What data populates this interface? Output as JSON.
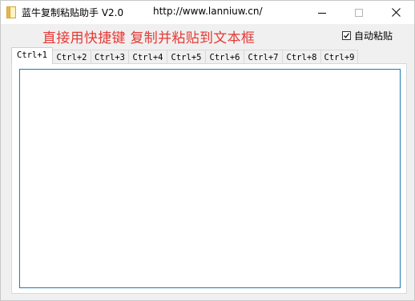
{
  "window": {
    "title": "蓝牛复制粘贴助手 V2.0",
    "url": "http://www.lanniuw.cn/",
    "controls": [
      "minimize-icon",
      "maximize-icon",
      "close-icon"
    ]
  },
  "banner": {
    "instruction": "直接用快捷键  复制并粘贴到文本框"
  },
  "auto_paste": {
    "label": "自动粘贴",
    "checked": true
  },
  "tabs": [
    {
      "label": "Ctrl+1",
      "active": true
    },
    {
      "label": "Ctrl+2",
      "active": false
    },
    {
      "label": "Ctrl+3",
      "active": false
    },
    {
      "label": "Ctrl+4",
      "active": false
    },
    {
      "label": "Ctrl+5",
      "active": false
    },
    {
      "label": "Ctrl+6",
      "active": false
    },
    {
      "label": "Ctrl+7",
      "active": false
    },
    {
      "label": "Ctrl+8",
      "active": false
    },
    {
      "label": "Ctrl+9",
      "active": false
    }
  ],
  "textbox": {
    "value": ""
  },
  "colors": {
    "instruction_red": "#e53935",
    "textbox_border": "#1f7ab5",
    "background": "#f0f0f0"
  }
}
